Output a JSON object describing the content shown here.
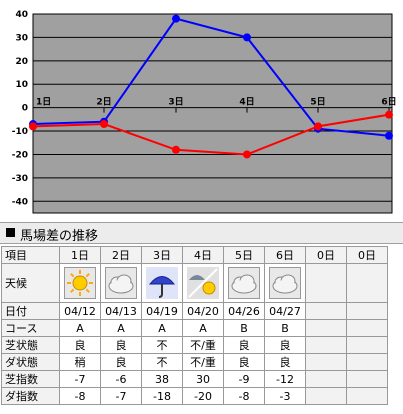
{
  "chart_data": {
    "type": "line",
    "x_labels": [
      "1日",
      "2日",
      "3日",
      "4日",
      "5日",
      "6日"
    ],
    "y_ticks": [
      40,
      30,
      20,
      10,
      0,
      -10,
      -20,
      -30,
      -40
    ],
    "ylim": [
      -45,
      40
    ],
    "grid": true,
    "series": [
      {
        "color": "#0000ff",
        "values": [
          -7,
          -6,
          38,
          30,
          -9,
          -12
        ]
      },
      {
        "color": "#ff0000",
        "values": [
          -8,
          -7,
          -18,
          -20,
          -8,
          -3
        ]
      }
    ]
  },
  "section_title": "馬場差の推移",
  "table": {
    "row_labels": [
      "項目",
      "天候",
      "日付",
      "コース",
      "芝状態",
      "ダ状態",
      "芝指数",
      "ダ指数"
    ],
    "columns": [
      {
        "day": "1日",
        "weather": "sunny-icon",
        "date": "04/12",
        "course": "A",
        "turf": "良",
        "dirt": "稍",
        "turf_index": "-7",
        "dirt_index": "-8"
      },
      {
        "day": "2日",
        "weather": "cloudy-icon",
        "date": "04/13",
        "course": "A",
        "turf": "良",
        "dirt": "良",
        "turf_index": "-6",
        "dirt_index": "-7"
      },
      {
        "day": "3日",
        "weather": "rain-icon",
        "date": "04/19",
        "course": "A",
        "turf": "不",
        "dirt": "不",
        "turf_index": "38",
        "dirt_index": "-18"
      },
      {
        "day": "4日",
        "weather": "rain-then-sunny-icon",
        "date": "04/20",
        "course": "A",
        "turf": "不/重",
        "dirt": "不/重",
        "turf_index": "30",
        "dirt_index": "-20"
      },
      {
        "day": "5日",
        "weather": "cloudy-icon",
        "date": "04/26",
        "course": "B",
        "turf": "良",
        "dirt": "良",
        "turf_index": "-9",
        "dirt_index": "-8"
      },
      {
        "day": "6日",
        "weather": "cloudy-icon",
        "date": "04/27",
        "course": "B",
        "turf": "良",
        "dirt": "良",
        "turf_index": "-12",
        "dirt_index": "-3"
      },
      {
        "day": "0日",
        "weather": "",
        "date": "",
        "course": "",
        "turf": "",
        "dirt": "",
        "turf_index": "",
        "dirt_index": ""
      },
      {
        "day": "0日",
        "weather": "",
        "date": "",
        "course": "",
        "turf": "",
        "dirt": "",
        "turf_index": "",
        "dirt_index": ""
      }
    ]
  }
}
